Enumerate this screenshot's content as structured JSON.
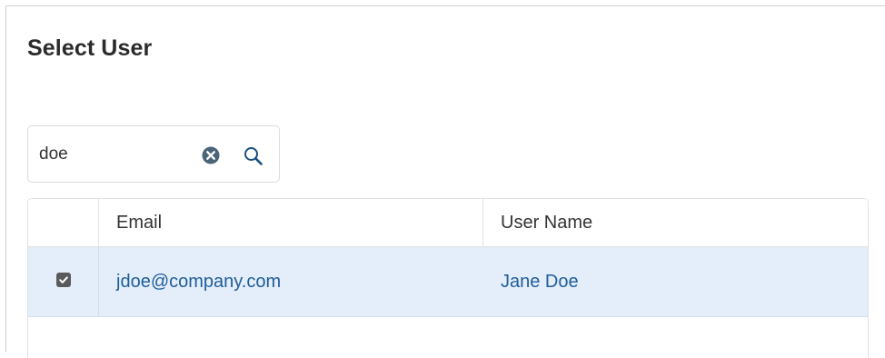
{
  "dialog": {
    "title": "Select User"
  },
  "search": {
    "value": "doe",
    "placeholder": "",
    "clear_icon": "clear-circle-icon",
    "search_icon": "magnifier-icon"
  },
  "grid": {
    "columns": [
      "",
      "Email",
      "User Name"
    ],
    "rows": [
      {
        "selected": true,
        "email": "jdoe@company.com",
        "user_name": "Jane Doe"
      }
    ]
  },
  "colors": {
    "selected_row_bg": "#e4eefa",
    "link_text": "#1f5d99",
    "clear_icon": "#4a6478",
    "search_icon": "#1a4f80"
  }
}
